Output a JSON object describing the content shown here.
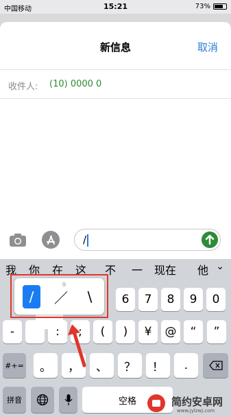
{
  "status_bar": {
    "carrier": "中国移动",
    "time": "15:21",
    "battery": "73%",
    "battery_level": 0.73
  },
  "nav": {
    "title": "新信息",
    "cancel": "取消"
  },
  "recipient": {
    "label": "收件人:",
    "value": "(10) 0000 0"
  },
  "message_input": {
    "text": "/"
  },
  "candidates": [
    "我",
    "你",
    "在",
    "这",
    "不",
    "一",
    "现在",
    "他"
  ],
  "popup": {
    "options": [
      "/",
      "／",
      "\\"
    ],
    "selected_index": 0,
    "quan_label": "全"
  },
  "keyboard": {
    "row1": [
      "6",
      "7",
      "8",
      "9",
      "0"
    ],
    "row2": [
      "-",
      "",
      ":",
      ";",
      "(",
      ")",
      "¥",
      "@",
      "“",
      "”"
    ],
    "row3": [
      "#+=",
      "。",
      "，",
      "、",
      "？",
      "！",
      "."
    ],
    "row4": {
      "pinyin": "拼音",
      "space": "空格"
    }
  },
  "watermark": {
    "text": "简约安卓网",
    "url": "www.jylzwj.com"
  },
  "colors": {
    "accent": "#2a7bd4",
    "send": "#2e8b3a",
    "highlight": "#e0362c",
    "selected": "#1a7cf2"
  }
}
